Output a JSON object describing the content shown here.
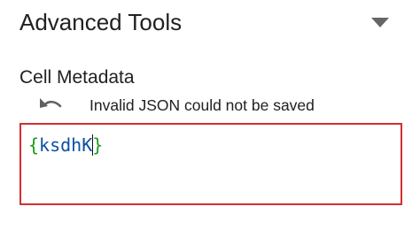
{
  "panel": {
    "title": "Advanced Tools",
    "collapse_icon": "caret-down-icon"
  },
  "cell_metadata": {
    "label": "Cell Metadata",
    "undo_icon": "undo-icon",
    "error_message": "Invalid JSON could not be saved",
    "editor": {
      "open_brace": "{",
      "text_before_cursor": "ksdhK",
      "text_after_cursor": "",
      "close_brace": "}",
      "border_color": "#d32f2f",
      "brace_color": "#1a9b1a",
      "text_color": "#0b4fa6"
    }
  }
}
